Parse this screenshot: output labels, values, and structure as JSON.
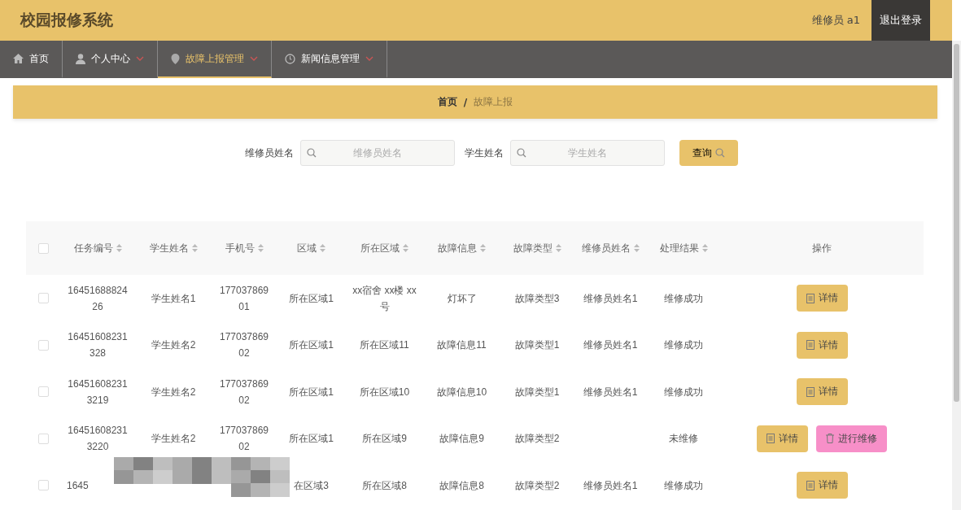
{
  "header": {
    "title": "校园报修系统",
    "user": "维修员 a1",
    "logout": "退出登录"
  },
  "nav": [
    {
      "label": "首页",
      "dropdown": false,
      "selected": false
    },
    {
      "label": "个人中心",
      "dropdown": true,
      "selected": false
    },
    {
      "label": "故障上报管理",
      "dropdown": true,
      "selected": true
    },
    {
      "label": "新闻信息管理",
      "dropdown": true,
      "selected": false
    }
  ],
  "breadcrumb": [
    {
      "label": "首页",
      "current": false
    },
    {
      "label": "故障上报",
      "current": true
    }
  ],
  "breadcrumb_separator": "/",
  "search": {
    "fields": [
      {
        "label": "维修员姓名",
        "placeholder": "维修员姓名"
      },
      {
        "label": "学生姓名",
        "placeholder": "学生姓名"
      }
    ],
    "button": "查询"
  },
  "table": {
    "all_checked": false,
    "columns": [
      {
        "label": "任务编号",
        "sortable": true
      },
      {
        "label": "学生姓名",
        "sortable": true
      },
      {
        "label": "手机号",
        "sortable": true
      },
      {
        "label": "区域",
        "sortable": true
      },
      {
        "label": "所在区域",
        "sortable": true
      },
      {
        "label": "故障信息",
        "sortable": true
      },
      {
        "label": "故障类型",
        "sortable": true
      },
      {
        "label": "维修员姓名",
        "sortable": true
      },
      {
        "label": "处理结果",
        "sortable": true
      },
      {
        "label": "操作",
        "sortable": false
      }
    ],
    "rows": [
      {
        "checked": false,
        "cells": [
          "1645168882426",
          "学生姓名1",
          "17703786901",
          "所在区域1",
          "xx宿舍 xx楼 xx号",
          "灯坏了",
          "故障类型3",
          "维修员姓名1",
          "维修成功"
        ],
        "actions": [
          {
            "label": "详情",
            "kind": "detail"
          }
        ],
        "obscured": false
      },
      {
        "checked": false,
        "cells": [
          "16451608231328",
          "学生姓名2",
          "17703786902",
          "所在区域1",
          "所在区域11",
          "故障信息11",
          "故障类型1",
          "维修员姓名1",
          "维修成功"
        ],
        "actions": [
          {
            "label": "详情",
            "kind": "detail"
          }
        ],
        "obscured": false
      },
      {
        "checked": false,
        "cells": [
          "164516082313219",
          "学生姓名2",
          "17703786902",
          "所在区域1",
          "所在区域10",
          "故障信息10",
          "故障类型1",
          "维修员姓名1",
          "维修成功"
        ],
        "actions": [
          {
            "label": "详情",
            "kind": "detail"
          }
        ],
        "obscured": false
      },
      {
        "checked": false,
        "cells": [
          "164516082313220",
          "学生姓名2",
          "17703786902",
          "所在区域1",
          "所在区域9",
          "故障信息9",
          "故障类型2",
          null,
          "未维修"
        ],
        "actions": [
          {
            "label": "详情",
            "kind": "detail"
          },
          {
            "label": "进行维修",
            "kind": "repair"
          }
        ],
        "obscured": false
      },
      {
        "checked": false,
        "cells": [
          "1645",
          null,
          null,
          "在区域3",
          "所在区域8",
          "故障信息8",
          "故障类型2",
          "维修员姓名1",
          "维修成功"
        ],
        "actions": [
          {
            "label": "详情",
            "kind": "detail"
          }
        ],
        "obscured": true
      }
    ]
  }
}
